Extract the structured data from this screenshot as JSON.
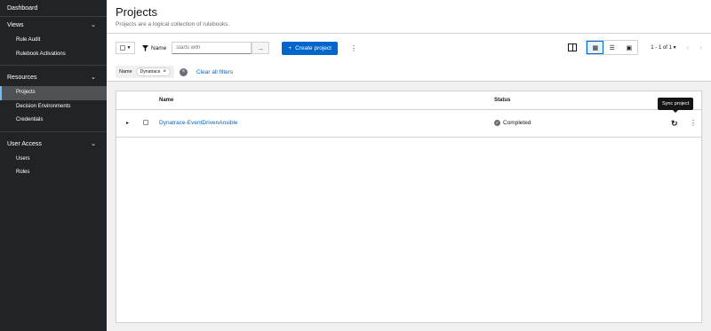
{
  "sidebar": {
    "dashboard": "Dashboard",
    "groups": [
      {
        "label": "Views",
        "items": [
          "Rule Audit",
          "Rulebook Activations"
        ]
      },
      {
        "label": "Resources",
        "items": [
          "Projects",
          "Decision Environments",
          "Credentials"
        ]
      },
      {
        "label": "User Access",
        "items": [
          "Users",
          "Roles"
        ]
      }
    ],
    "active_item": "Projects"
  },
  "header": {
    "title": "Projects",
    "subtitle": "Projects are a logical collection of rulebooks."
  },
  "toolbar": {
    "filter_label": "Name",
    "search_placeholder": "starts with",
    "create_label": "Create project",
    "pagination": "1 - 1 of 1"
  },
  "filters": {
    "group_label": "Name",
    "chip_value": "Dynatrace",
    "clear_label": "Clear all filters"
  },
  "table": {
    "columns": [
      "Name",
      "Status"
    ],
    "rows": [
      {
        "name": "Dynatrace-EventDrivenAnsible",
        "status": "Completed"
      }
    ]
  },
  "tooltip": "Sync project",
  "colors": {
    "accent": "#0066cc",
    "sidebar_bg": "#212427",
    "active_indicator": "#73bcf7"
  }
}
